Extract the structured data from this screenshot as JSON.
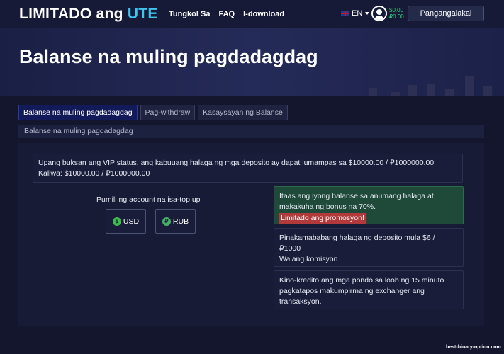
{
  "header": {
    "logo_main": "LIMITADO ang ",
    "logo_accent": "UTE",
    "nav": [
      "Tungkol Sa",
      "FAQ",
      "I-download"
    ],
    "language": "EN",
    "balance_usd": "$0.00",
    "balance_rub": "₽0.00",
    "login_label": "Pangangalakal"
  },
  "hero": {
    "title": "Balanse na muling pagdadagdag"
  },
  "tabs": [
    {
      "label": "Balanse na muling pagdadagdag",
      "active": true
    },
    {
      "label": "Pag-withdraw",
      "active": false
    },
    {
      "label": "Kasaysayan ng Balanse",
      "active": false
    }
  ],
  "breadcrumb": "Balanse na muling pagdadagdag",
  "vip": {
    "line1": "Upang buksan ang VIP status, ang kabuuang halaga ng mga deposito ay dapat lumampas sa $10000.00 / ₽1000000.00",
    "line2": "Kaliwa: $10000.00 / ₽1000000.00"
  },
  "account_select": {
    "label": "Pumili ng account na isa-top up",
    "options": [
      {
        "label": "USD",
        "icon": "dollar-coin-icon",
        "symbol": "$"
      },
      {
        "label": "RUB",
        "icon": "ruble-coin-icon",
        "symbol": "₽"
      }
    ]
  },
  "info": {
    "bonus_text": "Itaas ang iyong balanse sa anumang halaga at makakuha ng bonus na 70%.",
    "promo_label": "Limitado ang promosyon!",
    "min_deposit": "Pinakamababang halaga ng deposito mula $6 / ₽1000",
    "no_commission": "Walang komisyon",
    "credit_time": "Kino-kredito ang mga pondo sa loob ng 15 minuto pagkatapos makumpirma ng exchanger ang transaksyon."
  },
  "watermark": "best-binary-option.com",
  "colors": {
    "background": "#14162e",
    "accent": "#3fc4f0",
    "balance_green": "#37d07b",
    "bonus_box": "#1f4a3a",
    "promo_red": "#b23a3a"
  }
}
